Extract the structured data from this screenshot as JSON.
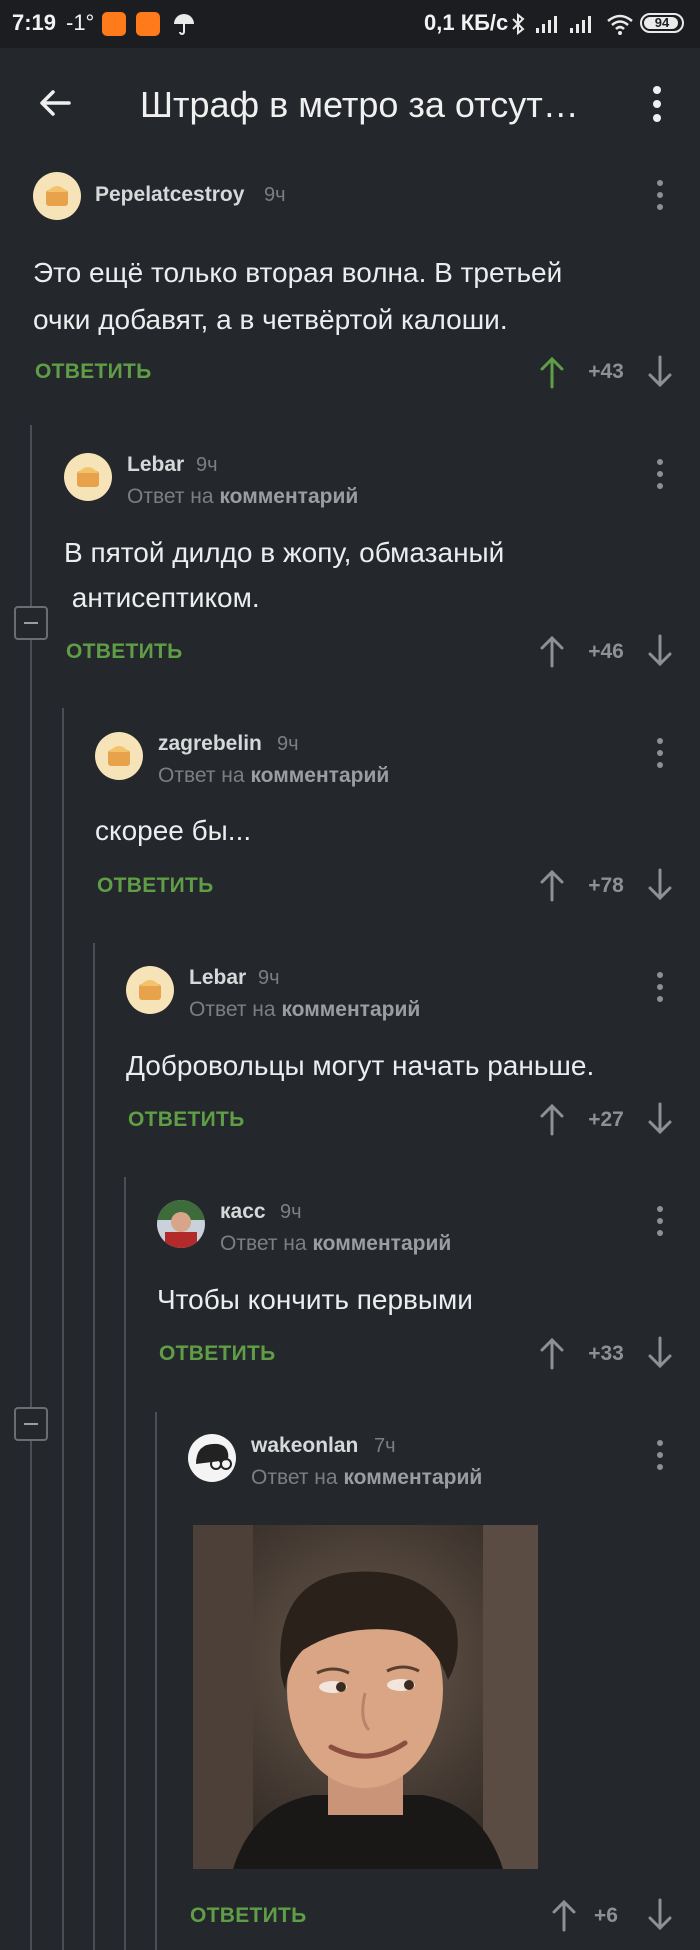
{
  "status_bar": {
    "time": "7:19",
    "temperature": "-1°",
    "net_speed": "0,1 КБ/с",
    "battery": "94"
  },
  "header": {
    "title": "Штраф в метро за отсут…",
    "back_icon": "arrow-left-icon",
    "menu_icon": "more-vertical-icon"
  },
  "labels": {
    "reply_to_prefix": "Ответ на",
    "reply_to_link": "комментарий",
    "reply_button": "ОТВЕТИТЬ"
  },
  "comments": [
    {
      "author": "Pepelatcestroy",
      "time": "9ч",
      "text_lines": [
        "Это ещё только вторая волна. В третьей",
        "очки добавят, а в четвёртой калоши."
      ],
      "score": "+43",
      "upvoted": true
    },
    {
      "author": "Lebar",
      "time": "9ч",
      "text_lines": [
        "В пятой дилдо в жопу, обмазаный",
        " антисептиком."
      ],
      "score": "+46",
      "upvoted": false
    },
    {
      "author": "zagrebelin",
      "time": "9ч",
      "text_lines": [
        "скорее бы..."
      ],
      "score": "+78",
      "upvoted": false
    },
    {
      "author": "Lebar",
      "time": "9ч",
      "text_lines": [
        "Добровольцы могут начать раньше."
      ],
      "score": "+27",
      "upvoted": false
    },
    {
      "author": "касс",
      "time": "9ч",
      "text_lines": [
        "Чтобы кончить первыми"
      ],
      "score": "+33",
      "upvoted": false
    },
    {
      "author": "wakeonlan",
      "time": "7ч",
      "text_lines": [],
      "score": "+6",
      "upvoted": false
    }
  ],
  "colors": {
    "background": "#24272b",
    "accent_green": "#5f9e46",
    "muted": "#7b7f84"
  }
}
